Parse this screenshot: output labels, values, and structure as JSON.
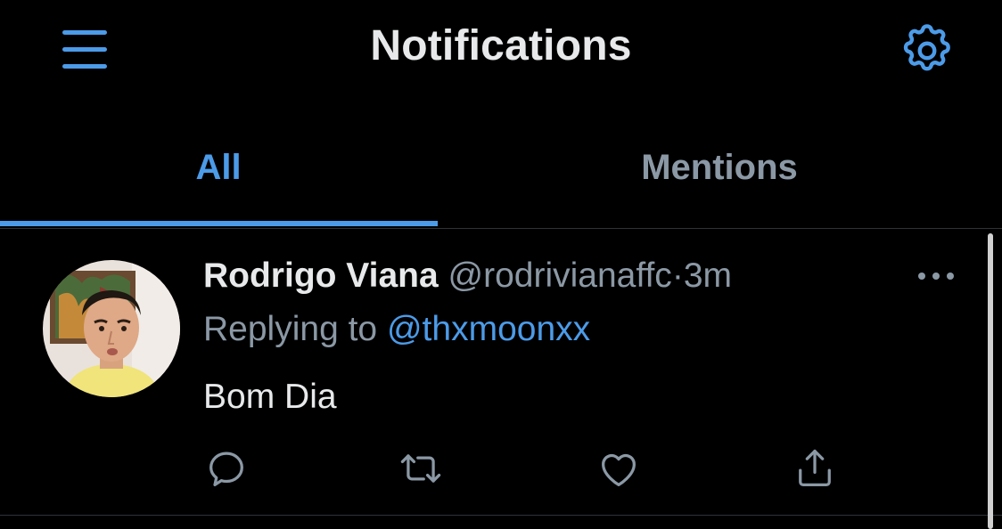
{
  "header": {
    "title": "Notifications",
    "menu_icon": "hamburger-menu-icon",
    "settings_icon": "gear-icon",
    "accent_color": "#4c9be8"
  },
  "tabs": [
    {
      "label": "All",
      "active": true
    },
    {
      "label": "Mentions",
      "active": false
    }
  ],
  "notification": {
    "author_name": "Rodrigo Viana",
    "author_handle": "@rodrivianaffc",
    "separator": "·",
    "time": "3m",
    "reply_prefix": "Replying to",
    "reply_to": "@thxmoonxx",
    "text": "Bom Dia",
    "actions": [
      "reply-icon",
      "retweet-icon",
      "like-icon",
      "share-icon"
    ],
    "more_icon": "more-options-icon"
  }
}
